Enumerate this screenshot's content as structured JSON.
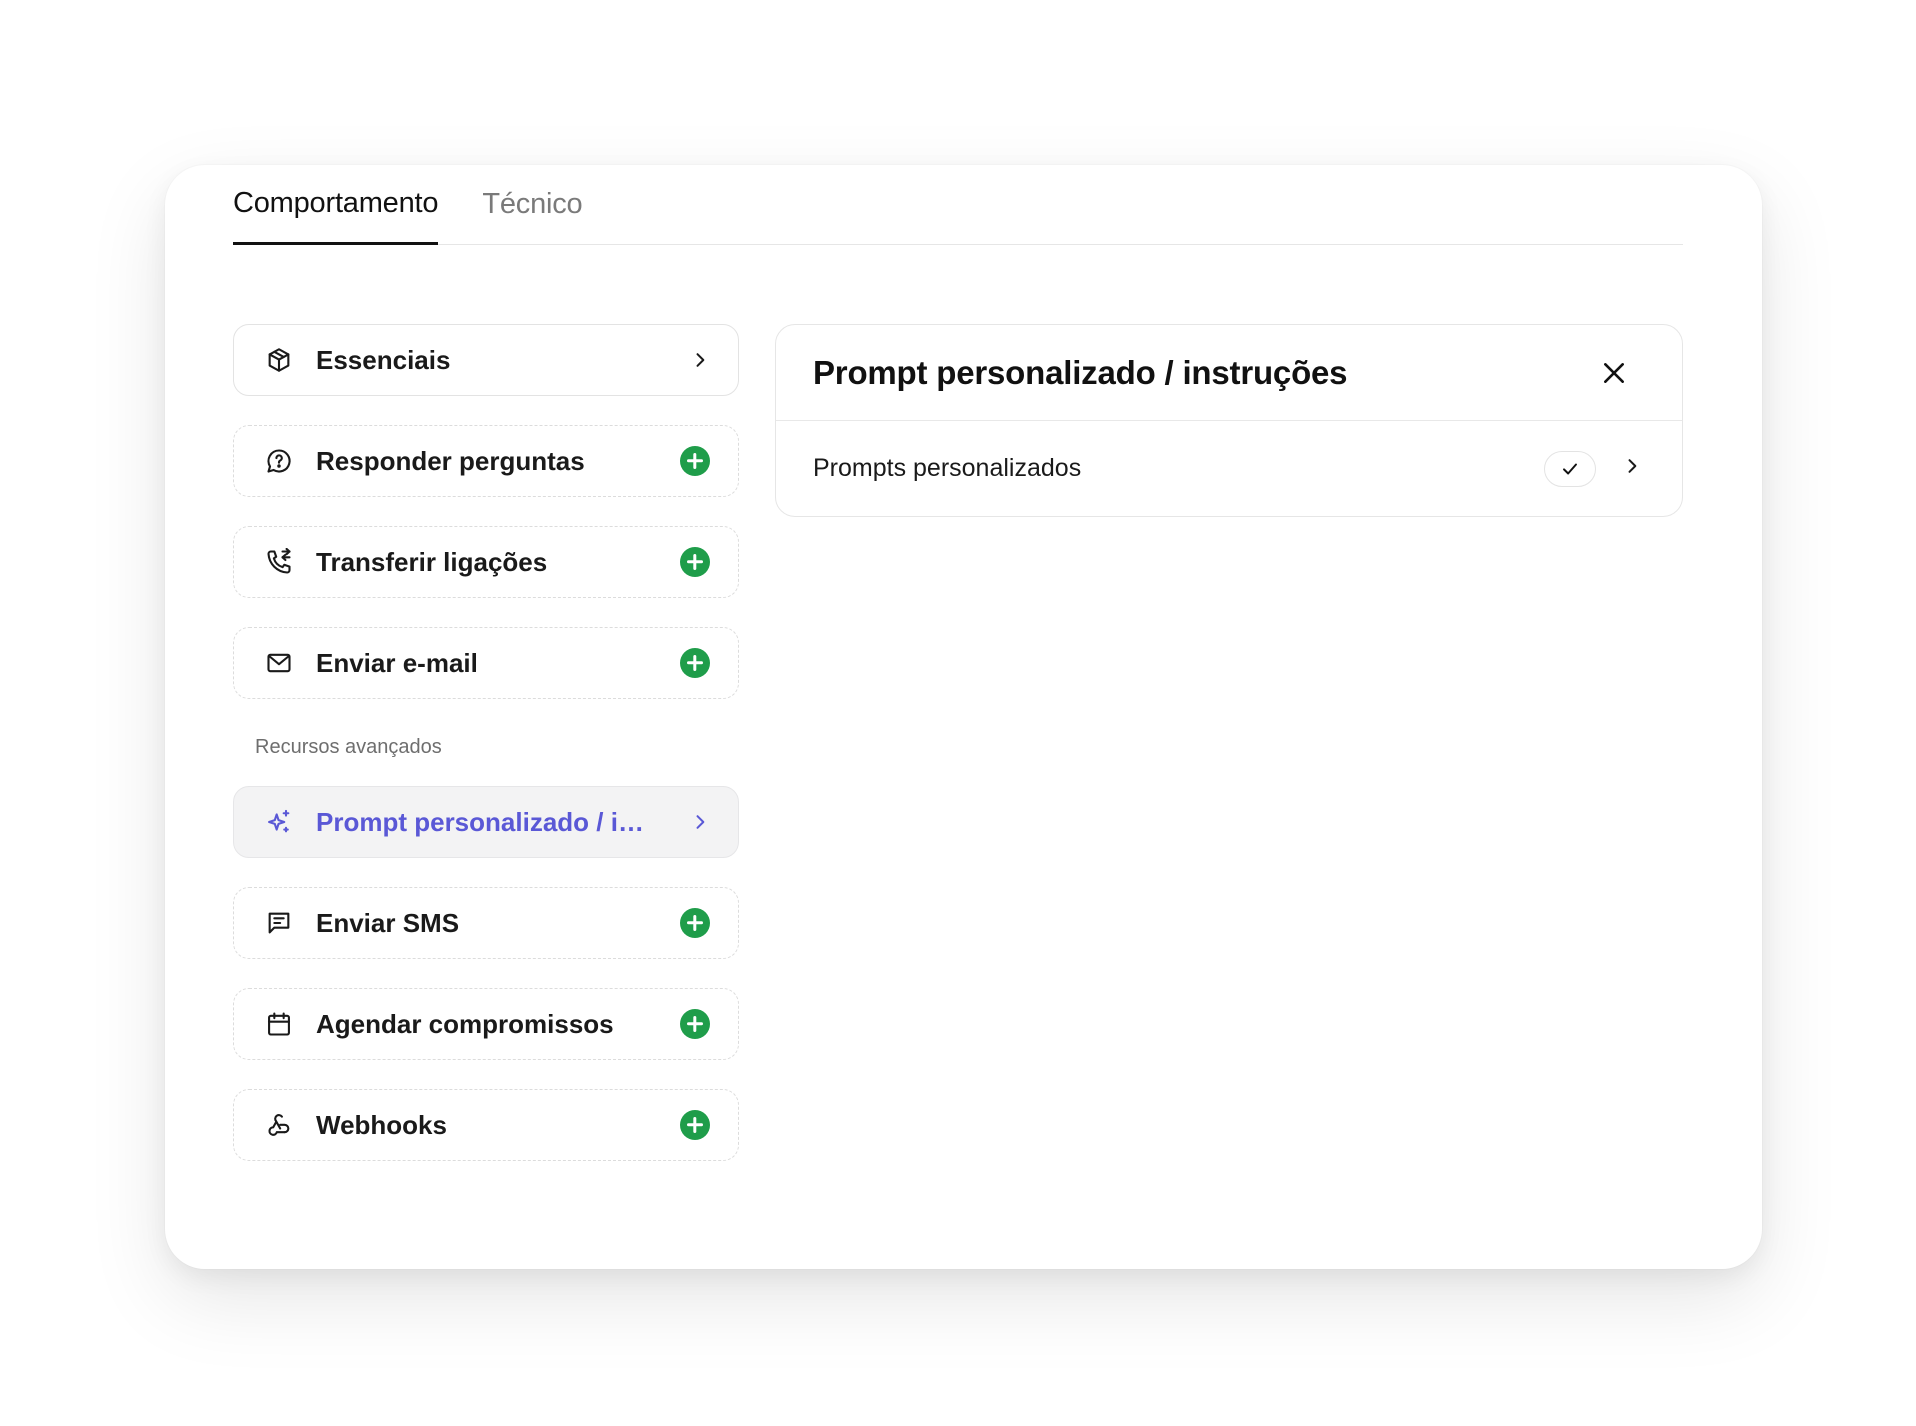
{
  "tabs": [
    {
      "label": "Comportamento",
      "active": true
    },
    {
      "label": "Técnico",
      "active": false
    }
  ],
  "items_top": [
    {
      "label": "Essenciais",
      "icon": "box-icon",
      "trailing": "chevron-right-icon"
    },
    {
      "label": "Responder perguntas",
      "icon": "question-chat-icon",
      "trailing": "add-icon"
    },
    {
      "label": "Transferir ligações",
      "icon": "phone-forward-icon",
      "trailing": "add-icon"
    },
    {
      "label": "Enviar e-mail",
      "icon": "mail-icon",
      "trailing": "add-icon"
    }
  ],
  "advanced_section_label": "Recursos avançados",
  "items_advanced": [
    {
      "label": "Prompt personalizado / in...",
      "icon": "sparkles-icon",
      "trailing": "chevron-right-icon",
      "selected": true
    },
    {
      "label": "Enviar SMS",
      "icon": "message-icon",
      "trailing": "add-icon"
    },
    {
      "label": "Agendar compromissos",
      "icon": "calendar-icon",
      "trailing": "add-icon"
    },
    {
      "label": "Webhooks",
      "icon": "webhook-icon",
      "trailing": "add-icon"
    }
  ],
  "panel": {
    "title": "Prompt personalizado / instruções",
    "row_label": "Prompts personalizados",
    "row_checked": true
  },
  "colors": {
    "accent": "#5a58d6",
    "add_green": "#1f9d4a",
    "text": "#1a1a1a",
    "muted": "#7a7a7a"
  }
}
